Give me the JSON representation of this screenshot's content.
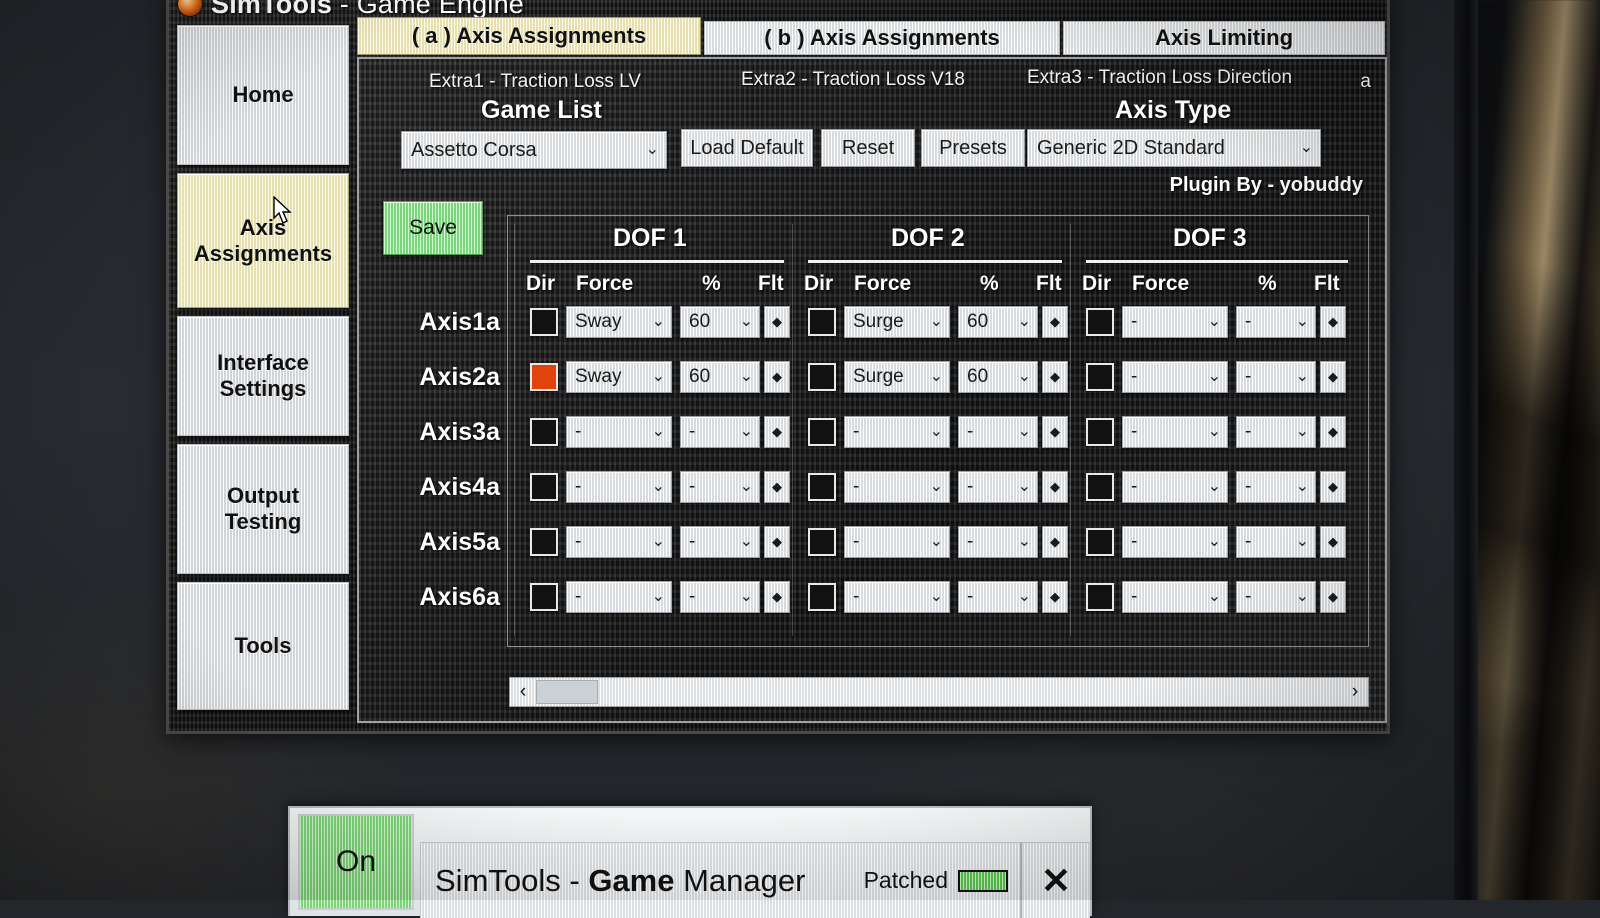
{
  "window": {
    "title_bold": "SimTools",
    "title_rest": " - Game Engine",
    "app_icon": "simtools-logo-icon"
  },
  "sidebar": {
    "items": [
      {
        "label": "Home",
        "name": "home"
      },
      {
        "label": "Axis\nAssignments",
        "name": "axis-assignments",
        "active": true
      },
      {
        "label": "Interface\nSettings",
        "name": "interface-settings"
      },
      {
        "label": "Output\nTesting",
        "name": "output-testing"
      },
      {
        "label": "Tools",
        "name": "tools"
      }
    ]
  },
  "tabs": [
    {
      "label": "( a ) Axis Assignments",
      "active": true
    },
    {
      "label": "( b ) Axis Assignments",
      "active": false
    },
    {
      "label": "Axis Limiting",
      "active": false
    }
  ],
  "content": {
    "extra1": "Extra1 - Traction Loss LV",
    "extra2": "Extra2 - Traction Loss V18",
    "extra3": "Extra3 - Traction Loss Direction",
    "corner_marker": "a",
    "game_list_title": "Game List",
    "axis_type_title": "Axis Type",
    "plugin_by": "Plugin By - yobuddy",
    "selected_game": "Assetto Corsa",
    "selected_axis_type": "Generic 2D Standard",
    "buttons": {
      "load_default": "Load Default",
      "reset": "Reset",
      "presets": "Presets",
      "save": "Save"
    },
    "chevron": "⌄"
  },
  "grid": {
    "dof_headers": [
      "DOF 1",
      "DOF 2",
      "DOF 3"
    ],
    "column_headers": [
      "Dir",
      "Force",
      "%",
      "Flt"
    ],
    "flt_glyph": "◆",
    "rows": [
      {
        "axis": "Axis1a",
        "dof1": {
          "dir_checked": false,
          "force": "Sway",
          "pct": "60",
          "flt": ""
        },
        "dof2": {
          "dir_checked": false,
          "force": "Surge",
          "pct": "60",
          "flt": ""
        },
        "dof3": {
          "dir_checked": false,
          "force": "-",
          "pct": "-",
          "flt": ""
        }
      },
      {
        "axis": "Axis2a",
        "dof1": {
          "dir_checked": true,
          "force": "Sway",
          "pct": "60",
          "flt": ""
        },
        "dof2": {
          "dir_checked": false,
          "force": "Surge",
          "pct": "60",
          "flt": ""
        },
        "dof3": {
          "dir_checked": false,
          "force": "-",
          "pct": "-",
          "flt": ""
        }
      },
      {
        "axis": "Axis3a",
        "dof1": {
          "dir_checked": false,
          "force": "-",
          "pct": "-",
          "flt": ""
        },
        "dof2": {
          "dir_checked": false,
          "force": "-",
          "pct": "-",
          "flt": ""
        },
        "dof3": {
          "dir_checked": false,
          "force": "-",
          "pct": "-",
          "flt": ""
        }
      },
      {
        "axis": "Axis4a",
        "dof1": {
          "dir_checked": false,
          "force": "-",
          "pct": "-",
          "flt": ""
        },
        "dof2": {
          "dir_checked": false,
          "force": "-",
          "pct": "-",
          "flt": ""
        },
        "dof3": {
          "dir_checked": false,
          "force": "-",
          "pct": "-",
          "flt": ""
        }
      },
      {
        "axis": "Axis5a",
        "dof1": {
          "dir_checked": false,
          "force": "-",
          "pct": "-",
          "flt": ""
        },
        "dof2": {
          "dir_checked": false,
          "force": "-",
          "pct": "-",
          "flt": ""
        },
        "dof3": {
          "dir_checked": false,
          "force": "-",
          "pct": "-",
          "flt": ""
        }
      },
      {
        "axis": "Axis6a",
        "dof1": {
          "dir_checked": false,
          "force": "-",
          "pct": "-",
          "flt": ""
        },
        "dof2": {
          "dir_checked": false,
          "force": "-",
          "pct": "-",
          "flt": ""
        },
        "dof3": {
          "dir_checked": false,
          "force": "-",
          "pct": "-",
          "flt": ""
        }
      }
    ]
  },
  "scrollbar": {
    "left_arrow": "‹",
    "right_arrow": "›"
  },
  "game_manager": {
    "on_label": "On",
    "title_plain_1": "SimTools - ",
    "title_bold": "Game",
    "title_plain_2": " Manager",
    "patched_label": "Patched",
    "close_label": "✕"
  },
  "colors": {
    "active_tab": "#eee6c0",
    "checked_dir": "#e2430e",
    "save_green": "#8fe08f",
    "led_green": "#79e06a",
    "panel_dark": "#1c1c1c"
  }
}
